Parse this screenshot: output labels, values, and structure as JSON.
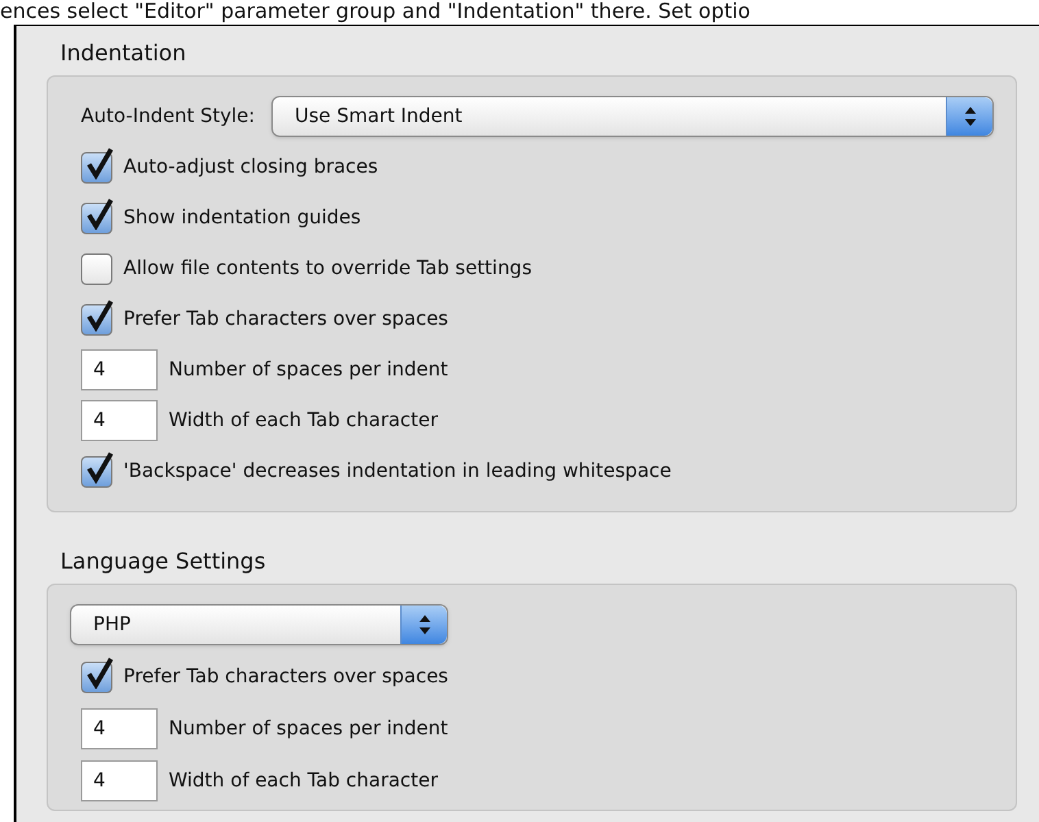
{
  "caption": "ences select \"Editor\" parameter group and \"Indentation\" there. Set optio",
  "sections": [
    {
      "title": "Indentation",
      "rows": [
        {
          "kind": "select",
          "label": "Auto-Indent Style:",
          "value": "Use Smart Indent"
        },
        {
          "kind": "checkbox",
          "label": "Auto-adjust closing braces",
          "checked": true
        },
        {
          "kind": "checkbox",
          "label": "Show indentation guides",
          "checked": true
        },
        {
          "kind": "checkbox",
          "label": "Allow file contents to override Tab settings",
          "checked": false
        },
        {
          "kind": "checkbox",
          "label": "Prefer Tab characters over spaces",
          "checked": true
        },
        {
          "kind": "number",
          "value": "4",
          "label": "Number of spaces per indent"
        },
        {
          "kind": "number",
          "value": "4",
          "label": "Width of each Tab character"
        },
        {
          "kind": "checkbox",
          "label": "'Backspace' decreases indentation in leading whitespace",
          "checked": true
        }
      ]
    },
    {
      "title": "Language Settings",
      "rows": [
        {
          "kind": "select",
          "value": "PHP"
        },
        {
          "kind": "checkbox",
          "label": "Prefer Tab characters over spaces",
          "checked": true
        },
        {
          "kind": "number",
          "value": "4",
          "label": "Number of spaces per indent"
        },
        {
          "kind": "number",
          "value": "4",
          "label": "Width of each Tab character"
        }
      ]
    }
  ]
}
